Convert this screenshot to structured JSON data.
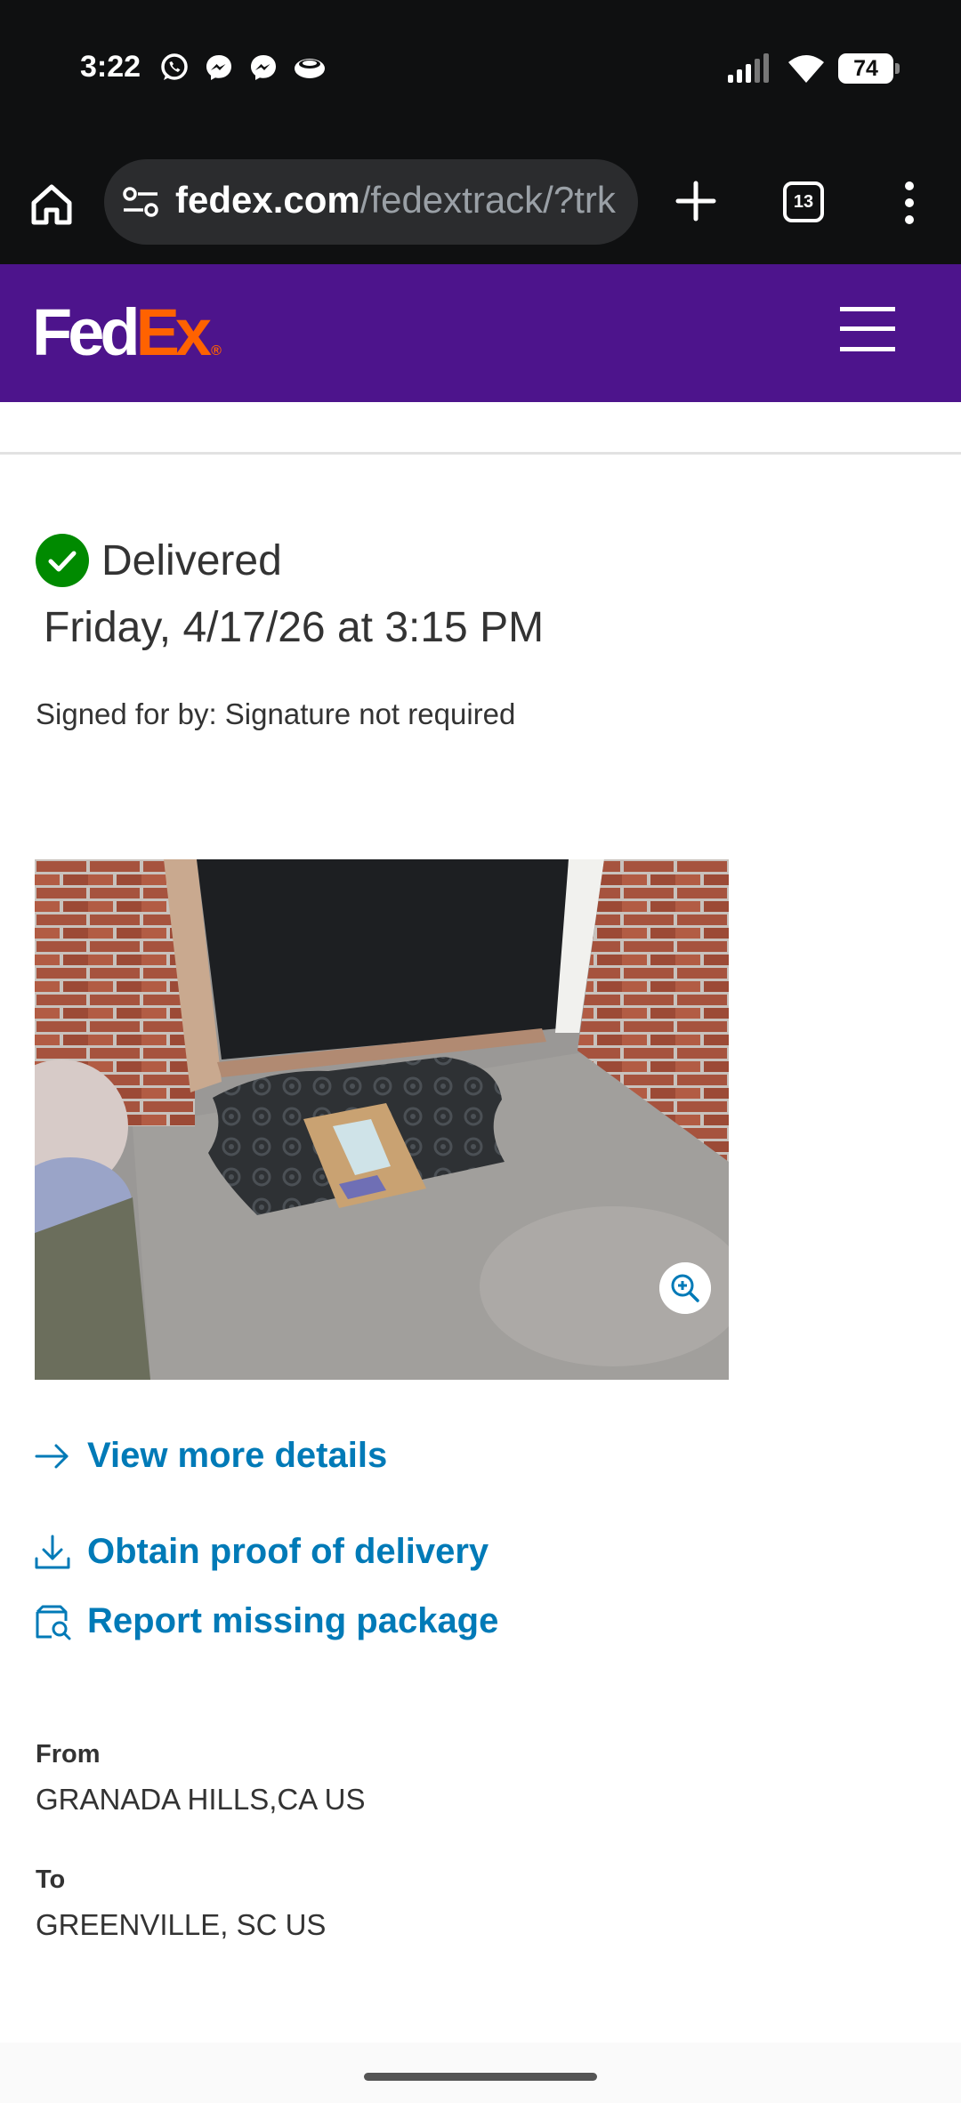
{
  "status_bar": {
    "time": "3:22",
    "battery": "74",
    "notification_icons": [
      "whatsapp-icon",
      "messenger-icon",
      "messenger-icon",
      "app-icon"
    ],
    "right_icons": [
      "signal-icon",
      "wifi-icon",
      "battery-icon"
    ]
  },
  "browser": {
    "url_host": "fedex.com",
    "url_path": "/fedextrack/?trk",
    "tab_count": "13",
    "icons": [
      "home-icon",
      "tune-icon",
      "plus-icon",
      "tabs-icon",
      "more-vert-icon"
    ]
  },
  "header": {
    "logo_fed": "Fed",
    "logo_ex": "Ex",
    "logo_reg": "®",
    "brand_purple": "#4d148c",
    "brand_orange": "#ff6200",
    "menu_icon": "hamburger-icon"
  },
  "tracking": {
    "status": "Delivered",
    "status_color": "#008a00",
    "delivered_at": "Friday, 4/17/26 at 3:15 PM",
    "signed_for": "Signed for by: Signature not required"
  },
  "photo": {
    "description_icon": "zoom-in-icon"
  },
  "links": {
    "color": "#007ab7",
    "view_more": "View more details",
    "proof_of_delivery": "Obtain proof of delivery",
    "report_missing": "Report missing package"
  },
  "shipment": {
    "from_label": "From",
    "from_value": "GRANADA HILLS,CA US",
    "to_label": "To",
    "to_value": "GREENVILLE, SC US"
  }
}
